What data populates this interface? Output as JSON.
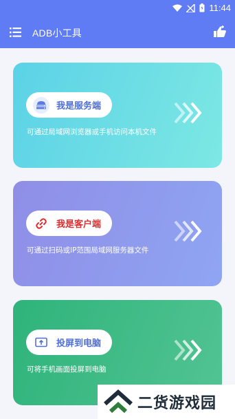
{
  "status_bar": {
    "time": "11:44",
    "icons": [
      "wifi-icon",
      "signal-icon",
      "battery-charging-icon"
    ]
  },
  "app_bar": {
    "title": "ADB小工具",
    "menu_icon": "menu-icon",
    "action_icon": "thumbs-up-icon"
  },
  "cards": [
    {
      "label": "我是服务端",
      "description": "可通过局域网浏览器或手机访问本机文件",
      "icon": "server-icon",
      "label_color": "#4f6fd8"
    },
    {
      "label": "我是客户端",
      "description": "可通过扫码或IP范围局域网服务器文件",
      "icon": "link-icon",
      "label_color": "#e12d2d"
    },
    {
      "label": "投屏到电脑",
      "description": "可将手机画面投屏到电脑",
      "icon": "screen-cast-icon",
      "label_color": "#4f6fd8"
    }
  ],
  "watermark": {
    "text": "二货游戏园"
  }
}
